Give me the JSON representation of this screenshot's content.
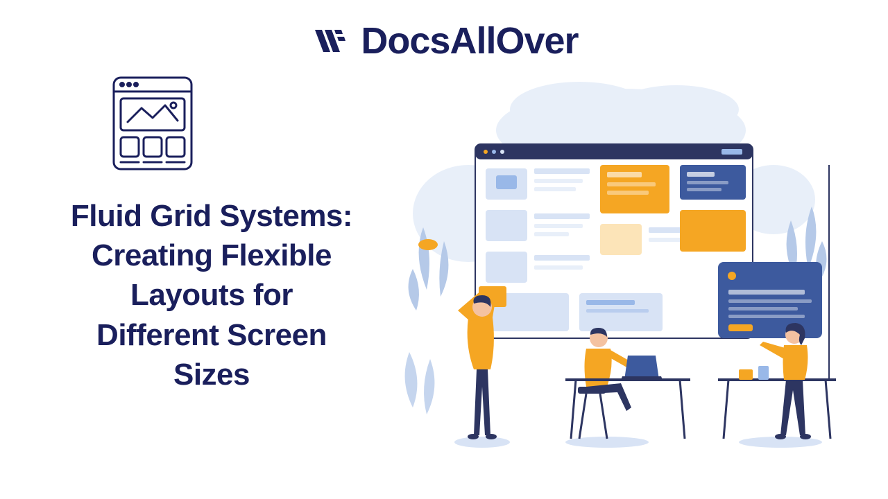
{
  "brand": {
    "name": "DocsAllOver",
    "logo_icon": "chevrons-logo-icon"
  },
  "page": {
    "title": "Fluid Grid Systems: Creating Flexible Layouts for Different Screen Sizes",
    "wireframe_icon": "wireframe-layout-icon"
  },
  "colors": {
    "primary": "#1a1f5c",
    "accent_orange": "#f5a623",
    "accent_blue": "#99b8e8",
    "illustration_navy": "#2d3561",
    "illustration_light": "#d8e3f5"
  }
}
